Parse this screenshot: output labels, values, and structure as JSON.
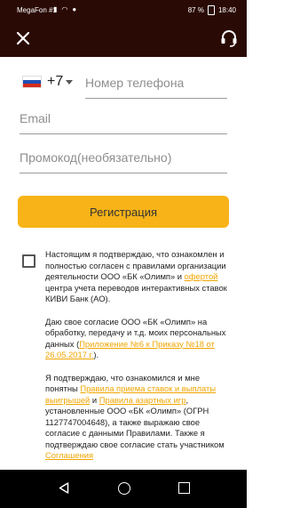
{
  "status_bar": {
    "carrier": "MegaFon #1",
    "battery": "87 %",
    "time": "18:40"
  },
  "phone": {
    "country_code": "+7",
    "placeholder": "Номер телефона",
    "value": ""
  },
  "email": {
    "placeholder": "Email",
    "value": ""
  },
  "promo": {
    "placeholder": "Промокод(необязательно)",
    "value": ""
  },
  "register_button": "Регистрация",
  "terms": {
    "p1_text1": "Настоящим я подтверждаю, что ознакомлен и полностью согласен с правилами организации деятельности ООО «БК «Олимп» и ",
    "p1_link": "офертой",
    "p1_text2": " центра учета переводов интерактивных ставок КИВИ Банк (АО).",
    "p2_text1": "Даю свое согласие ООО «БК «Олимп» на обработку, передачу и т.д. моих персональных данных (",
    "p2_link": "Приложение №6 к Приказу №18 от 26.05.2017 г.",
    "p2_text2": ").",
    "p3_text1": "Я подтверждаю, что ознакомился и мне понятны ",
    "p3_link1": "Правила приема ставок и выплаты выигрышей",
    "p3_text2": " и ",
    "p3_link2": "Правила азартных игр",
    "p3_text3": ", установленные ООО «БК «Олимп» (ОГРН 1127747004648), а также выражаю свое согласие с данными Правилами. Также я подтверждаю свое согласие стать участником ",
    "p3_link3": "Соглашения"
  },
  "colors": {
    "header_bg": "#2a0a05",
    "accent": "#f7b318",
    "link": "#f0a500"
  }
}
